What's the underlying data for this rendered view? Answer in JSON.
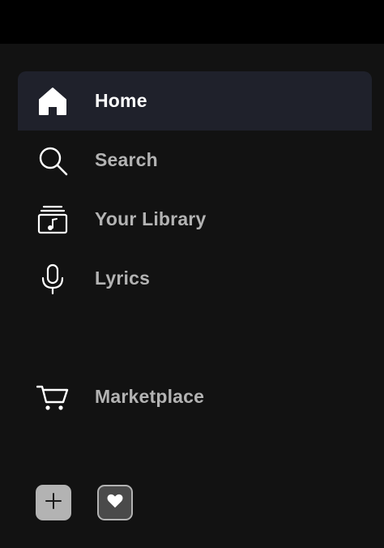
{
  "colors": {
    "topbar": "#000000",
    "sidebar_bg": "#121212",
    "active_bg": "#1f212b",
    "label_inactive": "#b3b3b3",
    "label_active": "#ffffff"
  },
  "nav": {
    "items": [
      {
        "id": "home",
        "label": "Home",
        "icon": "home-icon",
        "active": true
      },
      {
        "id": "search",
        "label": "Search",
        "icon": "search-icon",
        "active": false
      },
      {
        "id": "library",
        "label": "Your Library",
        "icon": "library-icon",
        "active": false
      },
      {
        "id": "lyrics",
        "label": "Lyrics",
        "icon": "microphone-icon",
        "active": false
      }
    ]
  },
  "marketplace": {
    "label": "Marketplace",
    "icon": "cart-icon"
  },
  "actions": {
    "create_playlist_icon": "plus-icon",
    "liked_songs_icon": "heart-icon"
  }
}
